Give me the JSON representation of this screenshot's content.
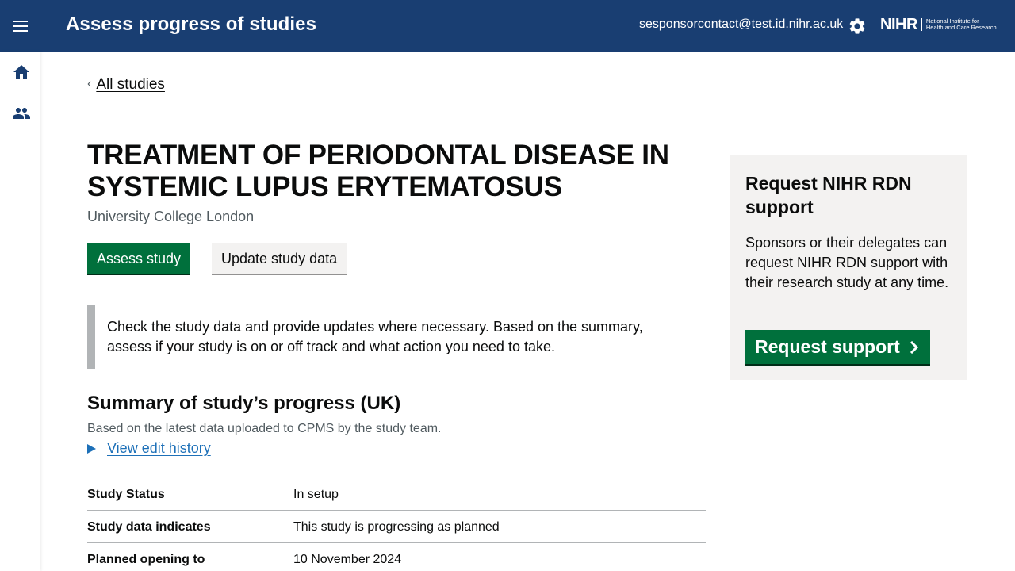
{
  "header": {
    "app_title": "Assess progress of studies",
    "user_email": "sesponsorcontact@test.id.nihr.ac.uk",
    "logo_text": "NIHR",
    "logo_subtext_line1": "National Institute for",
    "logo_subtext_line2": "Health and Care Research",
    "icons": [
      "menu-icon",
      "gear-icon"
    ]
  },
  "sidenav": {
    "icons": [
      "home-icon",
      "users-icon"
    ]
  },
  "breadcrumb": {
    "back_label": "All studies"
  },
  "study": {
    "title": "TREATMENT OF PERIODONTAL DISEASE IN SYSTEMIC LUPUS ERYTEMATOSUS",
    "organisation": "University College London"
  },
  "actions": {
    "assess_label": "Assess study",
    "update_label": "Update study data"
  },
  "inset_text": "Check the study data and provide updates where necessary. Based on the summary, assess if your study is on or off track and what action you need to take.",
  "summary": {
    "heading": "Summary of study’s progress (UK)",
    "note": "Based on the latest data uploaded to CPMS by the study team.",
    "details_label": "View edit history",
    "rows": [
      {
        "key": "Study Status",
        "value": "In setup"
      },
      {
        "key": "Study data indicates",
        "value": "This study is progressing as planned"
      },
      {
        "key": "Planned opening to",
        "value": "10 November 2024"
      }
    ]
  },
  "support_panel": {
    "heading": "Request NIHR RDN support",
    "body": "Sponsors or their delegates can request NIHR RDN support with their research study at any time.",
    "button_label": "Request support"
  },
  "colors": {
    "header_bg": "#193e72",
    "primary_green": "#00703c",
    "link_blue": "#1d70b8",
    "panel_bg": "#f3f2f1"
  }
}
